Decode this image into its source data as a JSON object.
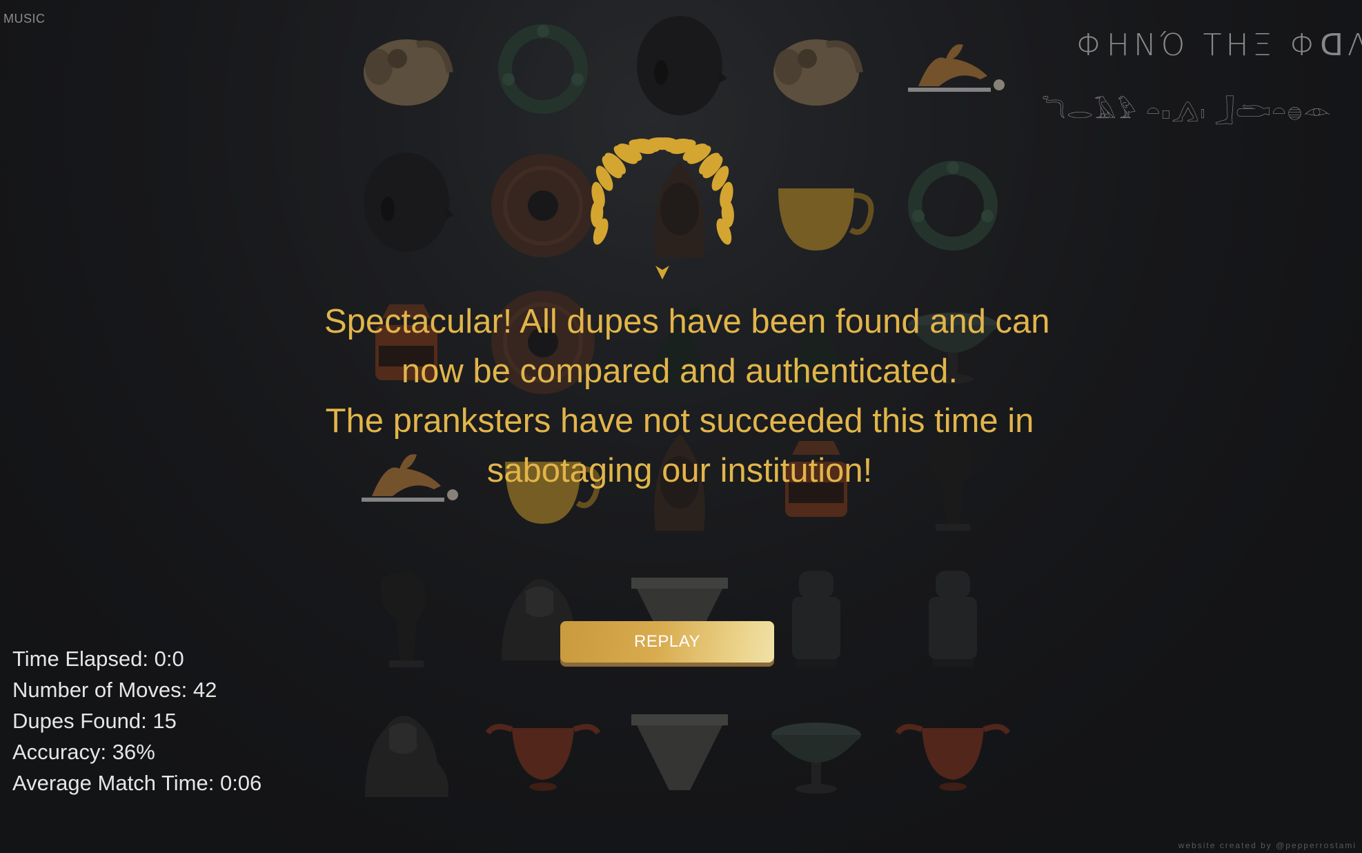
{
  "header": {
    "music_label": "MUSIC",
    "title": "ΦΗΝΌ ΤΗΞ ΦᗡΛVD!",
    "subtitle_glyphs": "𓆓𓂋𓄿𓅱 𓏏𓊪𓂻𓏤 𓃀𓂧𓏏𓐍𓁹"
  },
  "board": {
    "tiles": [
      {
        "icon": "ram-head-vessel-icon",
        "color": "#8a7556"
      },
      {
        "icon": "bronze-bracelet-icon",
        "color": "#2f4a3c"
      },
      {
        "icon": "black-stone-head-icon",
        "color": "#1e1e1f"
      },
      {
        "icon": "ram-head-vessel-icon",
        "color": "#8a7556"
      },
      {
        "icon": "horse-figurine-icon",
        "color": "#b07a3a"
      },
      {
        "icon": "black-stone-head-icon",
        "color": "#1e1e1f"
      },
      {
        "icon": "wooden-disc-icon",
        "color": "#4d3226"
      },
      {
        "icon": "bronze-head-icon",
        "color": "#3a2c24"
      },
      {
        "icon": "golden-cup-icon",
        "color": "#b48b2c"
      },
      {
        "icon": "bronze-bracelet-icon",
        "color": "#2f4a3c"
      },
      {
        "icon": "painted-pyxis-icon",
        "color": "#7a3a1e"
      },
      {
        "icon": "wooden-disc-icon",
        "color": "#4d3226"
      },
      {
        "icon": "bronze-horse-rider-icon",
        "color": "#1e2a24"
      },
      {
        "icon": "bronze-horse-rider-icon",
        "color": "#1e2a24"
      },
      {
        "icon": "green-bowl-icon",
        "color": "#3a4a44"
      },
      {
        "icon": "horse-figurine-icon",
        "color": "#b07a3a"
      },
      {
        "icon": "golden-cup-icon",
        "color": "#b48b2c"
      },
      {
        "icon": "bronze-head-icon",
        "color": "#3a2c24"
      },
      {
        "icon": "painted-pyxis-icon",
        "color": "#7a3a1e"
      },
      {
        "icon": "dark-bird-statue-icon",
        "color": "#202020"
      },
      {
        "icon": "dark-bird-statue-icon",
        "color": "#202020"
      },
      {
        "icon": "lamassu-icon",
        "color": "#2a2a2a"
      },
      {
        "icon": "stone-bowl-icon",
        "color": "#4b4b48"
      },
      {
        "icon": "sumerian-statue-icon",
        "color": "#2c2e30"
      },
      {
        "icon": "sumerian-statue-icon",
        "color": "#2c2e30"
      },
      {
        "icon": "lamassu-icon",
        "color": "#2a2a2a"
      },
      {
        "icon": "clay-skyphos-icon",
        "color": "#7a3320"
      },
      {
        "icon": "stone-bowl-icon",
        "color": "#4b4b48"
      },
      {
        "icon": "green-bowl-icon",
        "color": "#3a4a44"
      },
      {
        "icon": "clay-skyphos-icon",
        "color": "#7a3320"
      }
    ]
  },
  "result": {
    "line1": "Spectacular! All dupes have been found and can",
    "line2": "now be compared and authenticated.",
    "line3": "The pranksters have not succeeded this time in",
    "line4": "sabotaging our institution!",
    "replay_label": "REPLAY",
    "laurel_color": "#d4a530"
  },
  "stats": {
    "time_elapsed": "Time Elapsed: 0:0",
    "moves": "Number of Moves: 42",
    "dupes_found": "Dupes Found: 15",
    "accuracy": "Accuracy: 36%",
    "avg_match_time": "Average Match Time: 0:06"
  },
  "footer": {
    "credit": "website created by @pepperrostami"
  }
}
